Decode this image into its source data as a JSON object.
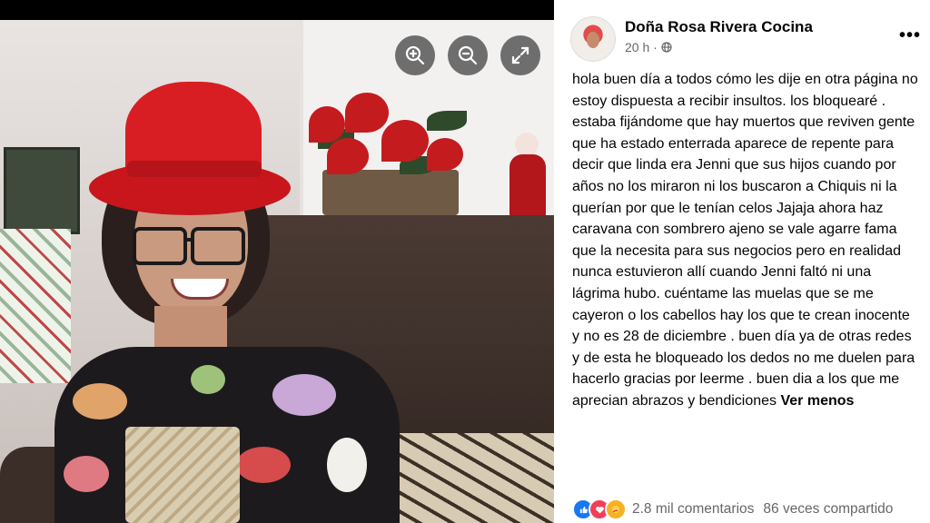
{
  "photo_viewer": {
    "controls": [
      {
        "name": "zoom-in",
        "icon": "zoom-in-icon"
      },
      {
        "name": "zoom-out",
        "icon": "zoom-out-icon"
      },
      {
        "name": "fullscreen",
        "icon": "expand-icon"
      }
    ]
  },
  "post": {
    "author": "Doña Rosa Rivera Cocina",
    "time": "20 h ·",
    "privacy_icon": "globe-icon",
    "more_icon": "more-options-icon",
    "more_label": "•••",
    "text": "hola buen día a todos cómo les dije en otra página no estoy dispuesta a recibir insultos. los bloquearé . estaba fijándome que hay muertos que reviven gente que ha estado enterrada aparece de repente para decir que linda era Jenni que sus hijos cuando por años no los miraron ni los buscaron a Chiquis ni la querían por que le tenían celos Jajaja ahora haz caravana con sombrero ajeno se vale agarre fama que la necesita para sus negocios pero en realidad nunca estuvieron allí cuando Jenni faltó ni una lágrima hubo. cuéntame las muelas que se me cayeron o los cabellos hay los que te crean inocente y no es 28 de diciembre . buen día ya de otras redes y de esta he bloqueado los dedos no me duelen para hacerlo gracias por leerme . buen dia a los que me aprecian abrazos y bendiciones",
    "see_less": "Ver menos"
  },
  "reactions": {
    "icons": [
      "like-icon",
      "love-icon",
      "care-icon"
    ],
    "comments": "2.8 mil comentarios",
    "shares": "86 veces compartido"
  },
  "colors": {
    "hat": "#d81e22",
    "panel_bg": "#ffffff",
    "text": "#050505",
    "muted": "#65676b",
    "like": "#1877f2",
    "love": "#f33e58"
  }
}
